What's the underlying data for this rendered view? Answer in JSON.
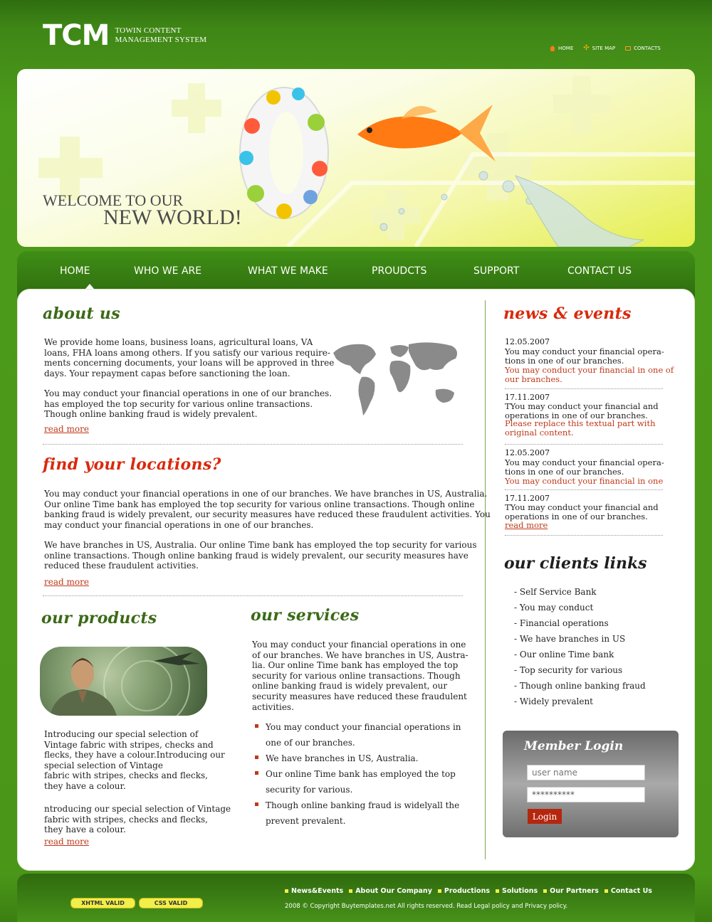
{
  "header": {
    "logo_mark": "TCM",
    "logo_sub_line1": "TOWIN CONTENT",
    "logo_sub_line2": "MANAGEMENT SYSTEM",
    "toplinks": [
      "HOME",
      "SITE MAP",
      "CONTACTS"
    ]
  },
  "banner": {
    "welcome_line1": "WELCOME TO OUR",
    "welcome_line2": "NEW WORLD!"
  },
  "nav": {
    "items": [
      "HOME",
      "WHO WE ARE",
      "WHAT WE MAKE",
      "PROUDCTS",
      "SUPPORT",
      "CONTACT US"
    ]
  },
  "about": {
    "title": "about us",
    "p1_lines": [
      "We provide home loans, business loans, agricultural loans, VA",
      "loans, FHA loans among others. If you satisfy our various require-",
      "ments concerning documents, your loans will be approved in three",
      "days. Your repayment capas before sanctioning the loan."
    ],
    "p2_lines": [
      "You may conduct your financial operations in one of our branches.",
      "has employed the top security for various online transactions.",
      "Though online banking fraud is widely prevalent."
    ],
    "read_more": "read more"
  },
  "locations": {
    "title": "find your locations?",
    "p1_lines": [
      "You may conduct your financial operations in one of our branches. We have branches in US, Australia.",
      "Our  online Time bank has employed the top security for various online transactions. Though online",
      "banking fraud is widely prevalent, our security measures have reduced these fraudulent activities. You",
      "may conduct your financial operations in one of our branches."
    ],
    "p2_lines": [
      "We have branches in US, Australia. Our  online Time bank has employed the top security for various",
      "online transactions. Though online banking fraud is widely prevalent, our security measures have",
      "reduced these fraudulent activities."
    ],
    "read_more": "read more"
  },
  "products": {
    "title": "our products",
    "p1_lines": [
      "Introducing our special selection of",
      "Vintage fabric with stripes, checks and",
      "flecks, they have a colour.Introducing our",
      "special selection of Vintage",
      "fabric with stripes, checks and flecks,",
      "they have a colour."
    ],
    "p2_lines": [
      "ntroducing our special selection of Vintage",
      "fabric with stripes, checks and flecks,",
      "they have a colour."
    ],
    "read_more": "read more"
  },
  "services": {
    "title": "our services",
    "p_lines": [
      "You may conduct your financial operations in one",
      "of our branches. We have branches in US, Austra-",
      "lia. Our  online Time bank has employed the top",
      "security for various online transactions. Though",
      "online banking fraud is widely prevalent, our",
      "security measures have reduced these fraudulent",
      "activities."
    ],
    "bullets": [
      "You may conduct your financial operations in",
      "one of our branches.",
      "We have branches in US, Australia.",
      "Our  online Time bank has employed the top",
      "security for various.",
      "Though online banking fraud is widelyall the",
      "prevent  prevalent."
    ]
  },
  "news": {
    "title": "news & events",
    "items": [
      {
        "date": "12.05.2007",
        "text": [
          "You may conduct your financial opera-",
          "tions in one of our branches."
        ],
        "red": [
          "You may conduct your financial in one of",
          "our branches."
        ]
      },
      {
        "date": "17.11.2007",
        "text": [
          "TYou may conduct your financial and",
          "operations in one of our branches."
        ],
        "red": [
          "Please replace this textual part with",
          "original content."
        ]
      },
      {
        "date": "12.05.2007",
        "text": [
          "You may conduct your financial opera-",
          "tions in one of our branches."
        ],
        "red": [
          "You may conduct your financial in one"
        ]
      },
      {
        "date": "17.11.2007",
        "text": [
          "TYou may conduct your financial and",
          "operations in one of our branches."
        ],
        "red": []
      }
    ],
    "read_more": "read more"
  },
  "clients": {
    "title": "our clients links",
    "items": [
      "- Self Service Bank",
      "- You may conduct",
      "- Financial operations",
      "- We have branches in US",
      "- Our  online Time bank",
      "- Top security for various",
      "- Though online banking fraud",
      "- Widely prevalent"
    ]
  },
  "login": {
    "title": "Member Login",
    "username_placeholder": "user name",
    "password_value": "**********",
    "button": "Login"
  },
  "footer": {
    "badges": [
      "XHTML VALID",
      "CSS VALID"
    ],
    "links": [
      "News&Events",
      "About Our Company",
      "Productions",
      "Solutions",
      "Our Partners",
      "Contact Us"
    ],
    "copyright": "2008 © Copyright Buytemplates.net  All rights reserved.  Read Legal policy and Privacy policy."
  },
  "colors": {
    "brand_green": "#4a9619",
    "heading_green": "#3c6a18",
    "accent_red": "#d9290c",
    "link_red": "#c0381a",
    "badge_yellow": "#f2ee4a"
  }
}
